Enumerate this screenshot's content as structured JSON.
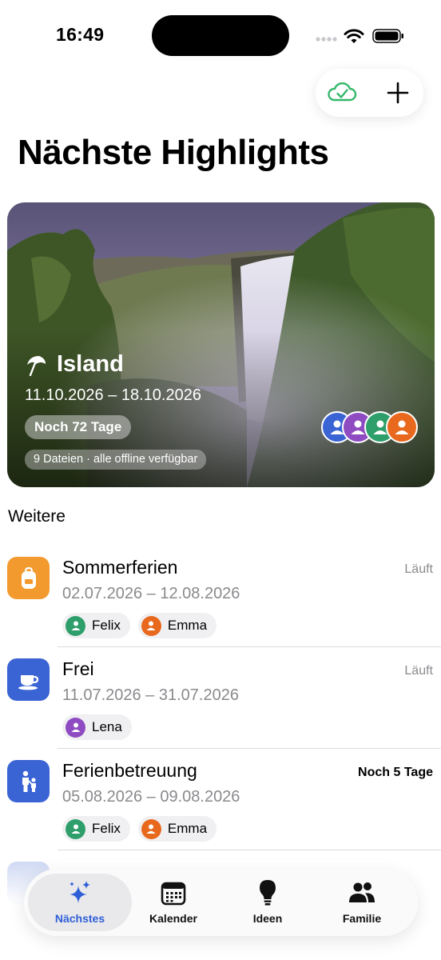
{
  "status_bar": {
    "time": "16:49"
  },
  "header": {
    "title": "Nächste Highlights"
  },
  "featured": {
    "title": "Island",
    "dates": "11.10.2026 – 18.10.2026",
    "countdown": "Noch 72 Tage",
    "files_info": "9 Dateien · alle offline verfügbar",
    "avatar_colors": [
      "#3a63d4",
      "#8e4bc2",
      "#2e9e6a",
      "#e8681d"
    ]
  },
  "section": {
    "title": "Weitere"
  },
  "events": [
    {
      "name": "Sommerferien",
      "dates": "02.07.2026 – 12.08.2026",
      "status": "Läuft",
      "icon": "backpack-icon",
      "icon_color": "#f29a2e",
      "participants": [
        {
          "name": "Felix",
          "color": "#2e9e6a"
        },
        {
          "name": "Emma",
          "color": "#e8681d"
        }
      ]
    },
    {
      "name": "Frei",
      "dates": "11.07.2026 – 31.07.2026",
      "status": "Läuft",
      "icon": "cup-icon",
      "icon_color": "#3a63d4",
      "participants": [
        {
          "name": "Lena",
          "color": "#8e4bc2"
        }
      ]
    },
    {
      "name": "Ferienbetreuung",
      "dates": "05.08.2026 – 09.08.2026",
      "status": "Noch 5 Tage",
      "icon": "parent-child-icon",
      "icon_color": "#3a63d4",
      "participants": [
        {
          "name": "Felix",
          "color": "#2e9e6a"
        },
        {
          "name": "Emma",
          "color": "#e8681d"
        }
      ]
    }
  ],
  "tabs": [
    {
      "label": "Nächstes",
      "icon": "sparkles-icon",
      "active": true
    },
    {
      "label": "Kalender",
      "icon": "calendar-icon",
      "active": false
    },
    {
      "label": "Ideen",
      "icon": "lightbulb-icon",
      "active": false
    },
    {
      "label": "Familie",
      "icon": "people-icon",
      "active": false
    }
  ]
}
